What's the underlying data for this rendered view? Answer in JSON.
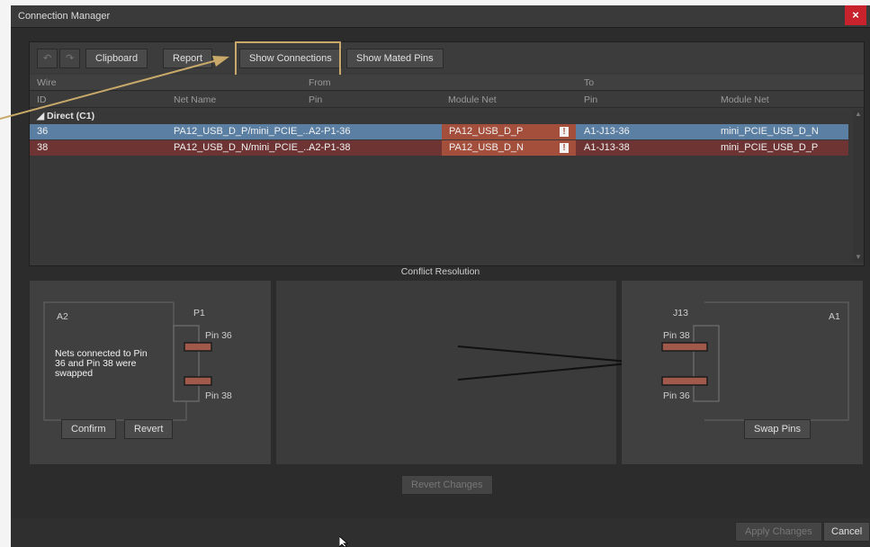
{
  "window": {
    "title": "Connection Manager",
    "close_symbol": "×"
  },
  "toolbar": {
    "undo_symbol": "↶",
    "redo_symbol": "↷",
    "clipboard": "Clipboard",
    "report": "Report",
    "show_connections": "Show Connections",
    "show_mated_pins": "Show Mated Pins"
  },
  "table": {
    "group_headers": {
      "wire": "Wire",
      "from": "From",
      "to": "To"
    },
    "columns": [
      "ID",
      "Net Name",
      "Pin",
      "Module Net",
      "Pin",
      "Module Net"
    ],
    "group_label": "◢ Direct (C1)",
    "rows": [
      {
        "id": "36",
        "net_name": "PA12_USB_D_P/mini_PCIE_...",
        "from_pin": "A2-P1-36",
        "from_module_net": "PA12_USB_D_P",
        "warn": "!",
        "to_pin": "A1-J13-36",
        "to_module_net": "mini_PCIE_USB_D_N"
      },
      {
        "id": "38",
        "net_name": "PA12_USB_D_N/mini_PCIE_...",
        "from_pin": "A2-P1-38",
        "from_module_net": "PA12_USB_D_N",
        "warn": "!",
        "to_pin": "A1-J13-38",
        "to_module_net": "mini_PCIE_USB_D_P"
      }
    ]
  },
  "conflict": {
    "title": "Conflict Resolution",
    "left": {
      "module": "A2",
      "connector": "P1",
      "pin_top": "Pin 36",
      "pin_bottom": "Pin 38",
      "message": "Nets connected to Pin 36 and Pin 38 were swapped",
      "confirm": "Confirm",
      "revert": "Revert"
    },
    "right": {
      "module": "A1",
      "connector": "J13",
      "pin_top": "Pin 38",
      "pin_bottom": "Pin 36",
      "swap": "Swap Pins"
    },
    "revert_changes": "Revert Changes"
  },
  "footer": {
    "apply_changes": "Apply Changes",
    "cancel": "Cancel"
  },
  "colors": {
    "accent_highlight": "#c8a969",
    "selected_row": "#5b7fa3",
    "error_row": "#6e3434",
    "module_net_error": "#a44e3c",
    "pin_fill": "#a0594a"
  }
}
